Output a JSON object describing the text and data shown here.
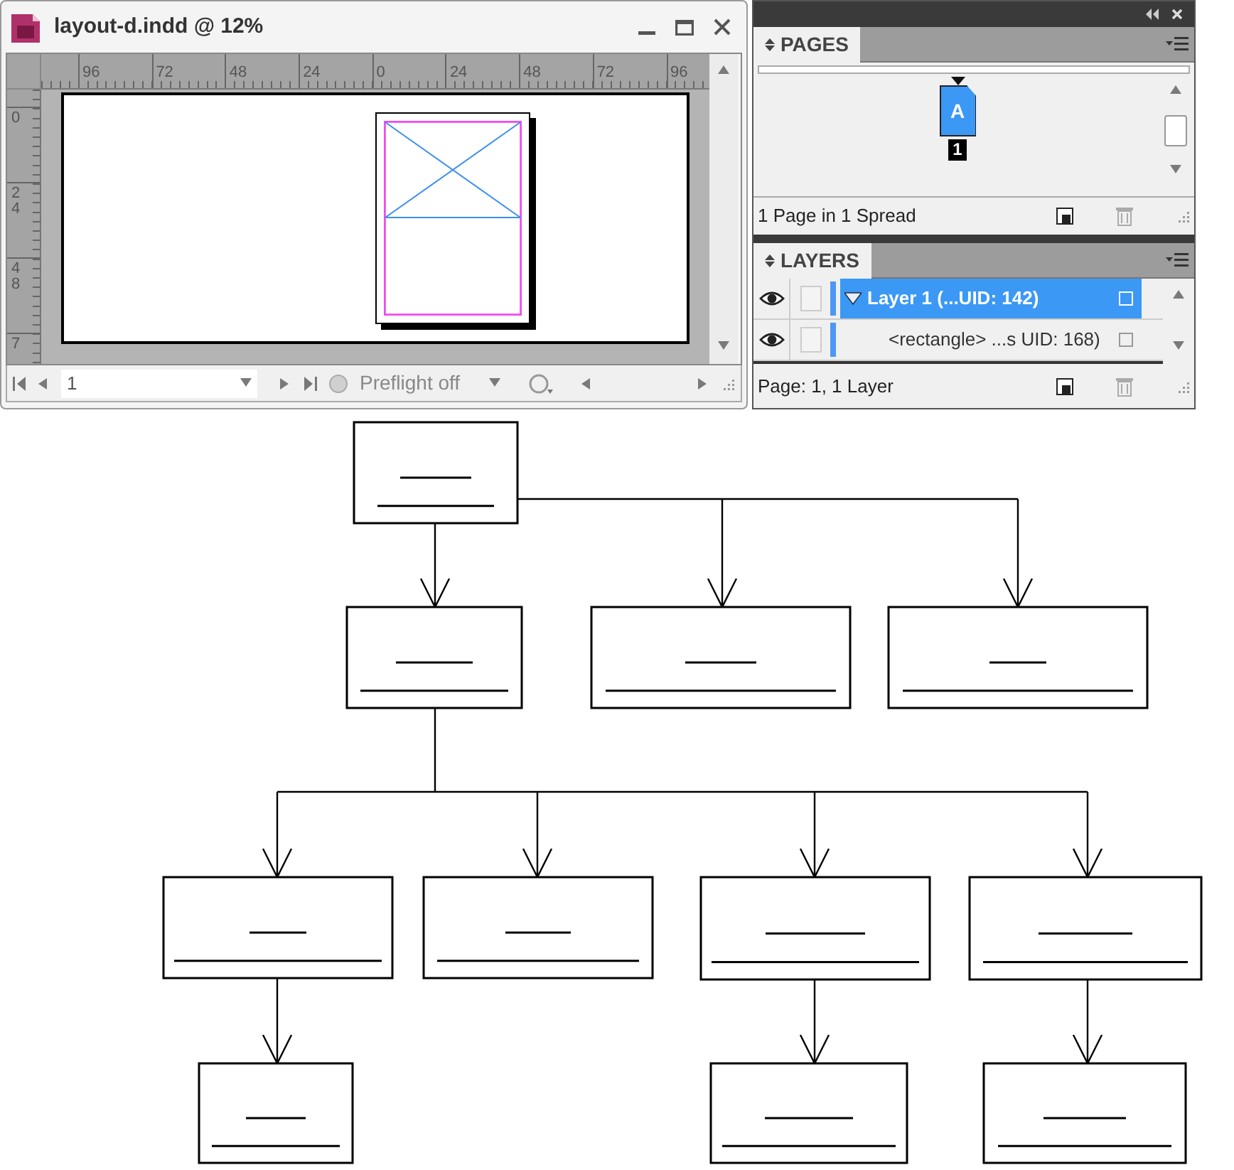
{
  "document_window": {
    "title": "layout-d.indd @ 12%",
    "horizontal_ruler": [
      "96",
      "72",
      "48",
      "24",
      "0",
      "24",
      "48",
      "72",
      "96"
    ],
    "vertical_ruler": [
      "0",
      "24",
      "48",
      "7"
    ],
    "page_field": "1",
    "preflight": "Preflight off"
  },
  "pages_panel": {
    "tab": "PAGES",
    "master_label": "A",
    "page_number": "1",
    "status": "1 Page in 1 Spread"
  },
  "layers_panel": {
    "tab": "LAYERS",
    "layers": [
      {
        "name": "Layer 1 (...UID: 142)",
        "selected": true,
        "visible": true,
        "expanded": true,
        "children": [
          {
            "name": "<rectangle> ...s UID: 168)",
            "selected": false,
            "visible": true
          }
        ]
      }
    ],
    "status": "Page: 1, 1 Layer"
  }
}
